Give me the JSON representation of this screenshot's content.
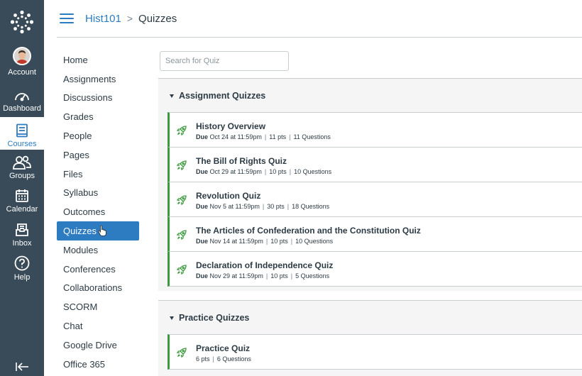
{
  "global_nav": {
    "items": [
      {
        "label": "Account",
        "icon": "avatar"
      },
      {
        "label": "Dashboard",
        "icon": "dashboard-icon"
      },
      {
        "label": "Courses",
        "icon": "courses-icon",
        "active": true
      },
      {
        "label": "Groups",
        "icon": "groups-icon"
      },
      {
        "label": "Calendar",
        "icon": "calendar-icon"
      },
      {
        "label": "Inbox",
        "icon": "inbox-icon"
      },
      {
        "label": "Help",
        "icon": "help-icon"
      }
    ],
    "colors": {
      "background": "#394b58",
      "active_text": "#2d7bc0"
    }
  },
  "header": {
    "course": "Hist101",
    "separator": ">",
    "current": "Quizzes"
  },
  "course_nav": {
    "items": [
      "Home",
      "Assignments",
      "Discussions",
      "Grades",
      "People",
      "Pages",
      "Files",
      "Syllabus",
      "Outcomes",
      "Quizzes",
      "Modules",
      "Conferences",
      "Collaborations",
      "SCORM",
      "Chat",
      "Google Drive",
      "Office 365"
    ],
    "active": "Quizzes"
  },
  "search": {
    "placeholder": "Search for Quiz"
  },
  "groups": [
    {
      "title": "Assignment Quizzes",
      "quizzes": [
        {
          "title": "History Overview",
          "due_label": "Due",
          "due": "Oct 24 at 11:59pm",
          "points": "11 pts",
          "questions": "11 Questions"
        },
        {
          "title": "The Bill of Rights Quiz",
          "due_label": "Due",
          "due": "Oct 29 at 11:59pm",
          "points": "10 pts",
          "questions": "10 Questions"
        },
        {
          "title": "Revolution Quiz",
          "due_label": "Due",
          "due": "Nov 5 at 11:59pm",
          "points": "30 pts",
          "questions": "18 Questions"
        },
        {
          "title": "The Articles of Confederation and the Constitution Quiz",
          "due_label": "Due",
          "due": "Nov 14 at 11:59pm",
          "points": "10 pts",
          "questions": "10 Questions"
        },
        {
          "title": "Declaration of Independence Quiz",
          "due_label": "Due",
          "due": "Nov 29 at 11:59pm",
          "points": "10 pts",
          "questions": "5 Questions"
        }
      ]
    },
    {
      "title": "Practice Quizzes",
      "quizzes": [
        {
          "title": "Practice Quiz",
          "points": "6 pts",
          "questions": "6 Questions"
        }
      ]
    }
  ],
  "accent_colors": {
    "link": "#2d7bc0",
    "published": "#3c9a3e"
  }
}
